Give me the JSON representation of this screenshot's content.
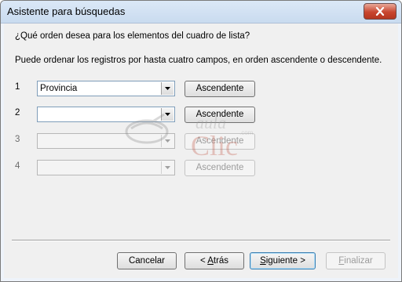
{
  "window": {
    "title": "Asistente para búsquedas"
  },
  "question": "¿Qué orden desea para los elementos del cuadro de lista?",
  "instructions": "Puede ordenar los registros por hasta cuatro campos, en orden ascendente o descendente.",
  "sort_rows": [
    {
      "number": "1",
      "field": "Provincia",
      "order": "Ascendente",
      "enabled": true
    },
    {
      "number": "2",
      "field": "",
      "order": "Ascendente",
      "enabled": true
    },
    {
      "number": "3",
      "field": "",
      "order": "Ascendente",
      "enabled": false
    },
    {
      "number": "4",
      "field": "",
      "order": "Ascendente",
      "enabled": false
    }
  ],
  "watermark": {
    "word1": "aula",
    "word2": "Clic",
    "suffix": ".com"
  },
  "buttons": {
    "cancel": "Cancelar",
    "back_prefix": "< ",
    "back_key": "A",
    "back_rest": "trás",
    "next_key": "S",
    "next_rest": "iguiente >",
    "finish_key": "F",
    "finish_rest": "inalizar"
  },
  "colors": {
    "titlebar": "#c9dbef",
    "close": "#c8462f",
    "default_border": "#3c7fb1"
  }
}
